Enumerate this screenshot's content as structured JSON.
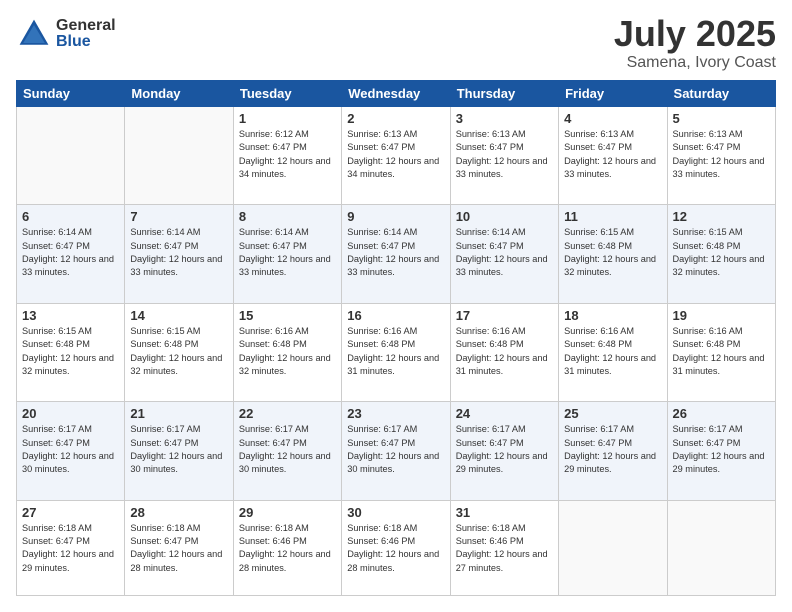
{
  "header": {
    "logo_general": "General",
    "logo_blue": "Blue",
    "month": "July 2025",
    "location": "Samena, Ivory Coast"
  },
  "days_of_week": [
    "Sunday",
    "Monday",
    "Tuesday",
    "Wednesday",
    "Thursday",
    "Friday",
    "Saturday"
  ],
  "weeks": [
    [
      {
        "day": "",
        "info": ""
      },
      {
        "day": "",
        "info": ""
      },
      {
        "day": "1",
        "info": "Sunrise: 6:12 AM\nSunset: 6:47 PM\nDaylight: 12 hours and 34 minutes."
      },
      {
        "day": "2",
        "info": "Sunrise: 6:13 AM\nSunset: 6:47 PM\nDaylight: 12 hours and 34 minutes."
      },
      {
        "day": "3",
        "info": "Sunrise: 6:13 AM\nSunset: 6:47 PM\nDaylight: 12 hours and 33 minutes."
      },
      {
        "day": "4",
        "info": "Sunrise: 6:13 AM\nSunset: 6:47 PM\nDaylight: 12 hours and 33 minutes."
      },
      {
        "day": "5",
        "info": "Sunrise: 6:13 AM\nSunset: 6:47 PM\nDaylight: 12 hours and 33 minutes."
      }
    ],
    [
      {
        "day": "6",
        "info": "Sunrise: 6:14 AM\nSunset: 6:47 PM\nDaylight: 12 hours and 33 minutes."
      },
      {
        "day": "7",
        "info": "Sunrise: 6:14 AM\nSunset: 6:47 PM\nDaylight: 12 hours and 33 minutes."
      },
      {
        "day": "8",
        "info": "Sunrise: 6:14 AM\nSunset: 6:47 PM\nDaylight: 12 hours and 33 minutes."
      },
      {
        "day": "9",
        "info": "Sunrise: 6:14 AM\nSunset: 6:47 PM\nDaylight: 12 hours and 33 minutes."
      },
      {
        "day": "10",
        "info": "Sunrise: 6:14 AM\nSunset: 6:47 PM\nDaylight: 12 hours and 33 minutes."
      },
      {
        "day": "11",
        "info": "Sunrise: 6:15 AM\nSunset: 6:48 PM\nDaylight: 12 hours and 32 minutes."
      },
      {
        "day": "12",
        "info": "Sunrise: 6:15 AM\nSunset: 6:48 PM\nDaylight: 12 hours and 32 minutes."
      }
    ],
    [
      {
        "day": "13",
        "info": "Sunrise: 6:15 AM\nSunset: 6:48 PM\nDaylight: 12 hours and 32 minutes."
      },
      {
        "day": "14",
        "info": "Sunrise: 6:15 AM\nSunset: 6:48 PM\nDaylight: 12 hours and 32 minutes."
      },
      {
        "day": "15",
        "info": "Sunrise: 6:16 AM\nSunset: 6:48 PM\nDaylight: 12 hours and 32 minutes."
      },
      {
        "day": "16",
        "info": "Sunrise: 6:16 AM\nSunset: 6:48 PM\nDaylight: 12 hours and 31 minutes."
      },
      {
        "day": "17",
        "info": "Sunrise: 6:16 AM\nSunset: 6:48 PM\nDaylight: 12 hours and 31 minutes."
      },
      {
        "day": "18",
        "info": "Sunrise: 6:16 AM\nSunset: 6:48 PM\nDaylight: 12 hours and 31 minutes."
      },
      {
        "day": "19",
        "info": "Sunrise: 6:16 AM\nSunset: 6:48 PM\nDaylight: 12 hours and 31 minutes."
      }
    ],
    [
      {
        "day": "20",
        "info": "Sunrise: 6:17 AM\nSunset: 6:47 PM\nDaylight: 12 hours and 30 minutes."
      },
      {
        "day": "21",
        "info": "Sunrise: 6:17 AM\nSunset: 6:47 PM\nDaylight: 12 hours and 30 minutes."
      },
      {
        "day": "22",
        "info": "Sunrise: 6:17 AM\nSunset: 6:47 PM\nDaylight: 12 hours and 30 minutes."
      },
      {
        "day": "23",
        "info": "Sunrise: 6:17 AM\nSunset: 6:47 PM\nDaylight: 12 hours and 30 minutes."
      },
      {
        "day": "24",
        "info": "Sunrise: 6:17 AM\nSunset: 6:47 PM\nDaylight: 12 hours and 29 minutes."
      },
      {
        "day": "25",
        "info": "Sunrise: 6:17 AM\nSunset: 6:47 PM\nDaylight: 12 hours and 29 minutes."
      },
      {
        "day": "26",
        "info": "Sunrise: 6:17 AM\nSunset: 6:47 PM\nDaylight: 12 hours and 29 minutes."
      }
    ],
    [
      {
        "day": "27",
        "info": "Sunrise: 6:18 AM\nSunset: 6:47 PM\nDaylight: 12 hours and 29 minutes."
      },
      {
        "day": "28",
        "info": "Sunrise: 6:18 AM\nSunset: 6:47 PM\nDaylight: 12 hours and 28 minutes."
      },
      {
        "day": "29",
        "info": "Sunrise: 6:18 AM\nSunset: 6:46 PM\nDaylight: 12 hours and 28 minutes."
      },
      {
        "day": "30",
        "info": "Sunrise: 6:18 AM\nSunset: 6:46 PM\nDaylight: 12 hours and 28 minutes."
      },
      {
        "day": "31",
        "info": "Sunrise: 6:18 AM\nSunset: 6:46 PM\nDaylight: 12 hours and 27 minutes."
      },
      {
        "day": "",
        "info": ""
      },
      {
        "day": "",
        "info": ""
      }
    ]
  ]
}
